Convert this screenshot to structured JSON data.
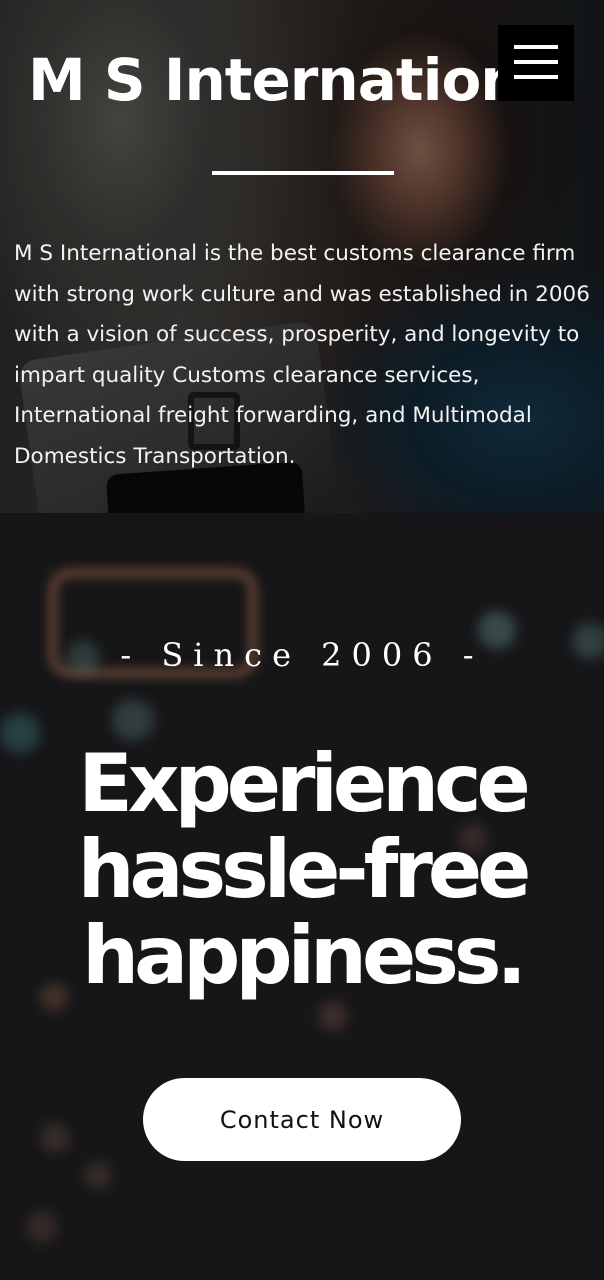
{
  "header": {
    "brand_title": "M S International",
    "menu_icon": "hamburger-menu-icon"
  },
  "hero": {
    "description": "M S International is the best customs clearance firm with strong work culture and was established in 2006 with a vision of success, prosperity, and longevity to impart quality Customs clearance services, International freight forwarding, and Multimodal Domestics Transportation."
  },
  "promo": {
    "since": "- Since 2006 -",
    "tagline_line1": "Experience",
    "tagline_line2": "hassle-free",
    "tagline_line3": "happiness.",
    "contact_label": "Contact Now"
  },
  "colors": {
    "text": "#ffffff",
    "dark_background": "#161618",
    "button_background": "#ffffff",
    "button_text": "#111111"
  }
}
